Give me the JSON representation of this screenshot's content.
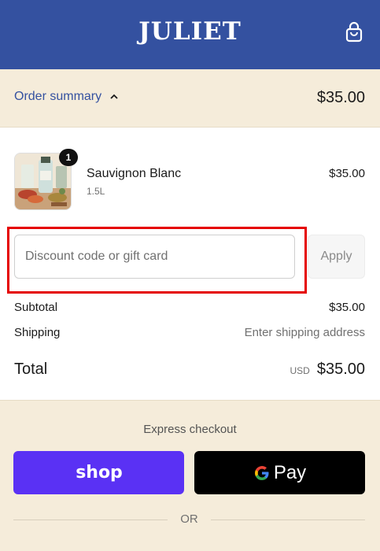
{
  "header": {
    "logo": "JULIET",
    "cart_icon": "shopping-bag-icon"
  },
  "order_summary": {
    "toggle_label": "Order summary",
    "toggle_icon": "chevron-up-icon",
    "total": "$35.00"
  },
  "product": {
    "name": "Sauvignon Blanc",
    "variant": "1.5L",
    "price": "$35.00",
    "quantity": "1",
    "thumbnail_icon": "product-photo"
  },
  "discount": {
    "placeholder": "Discount code or gift card",
    "value": "",
    "apply_label": "Apply"
  },
  "totals": {
    "subtotal_label": "Subtotal",
    "subtotal_value": "$35.00",
    "shipping_label": "Shipping",
    "shipping_value": "Enter shipping address",
    "total_label": "Total",
    "currency": "USD",
    "total_value": "$35.00"
  },
  "express": {
    "title": "Express checkout",
    "shop_label": "shop",
    "gpay_label": "Pay",
    "or_label": "OR"
  },
  "colors": {
    "brand": "#3451a0",
    "summary_bg": "#f5ecda",
    "shop_pay": "#5a31f4",
    "highlight": "#e50000"
  }
}
